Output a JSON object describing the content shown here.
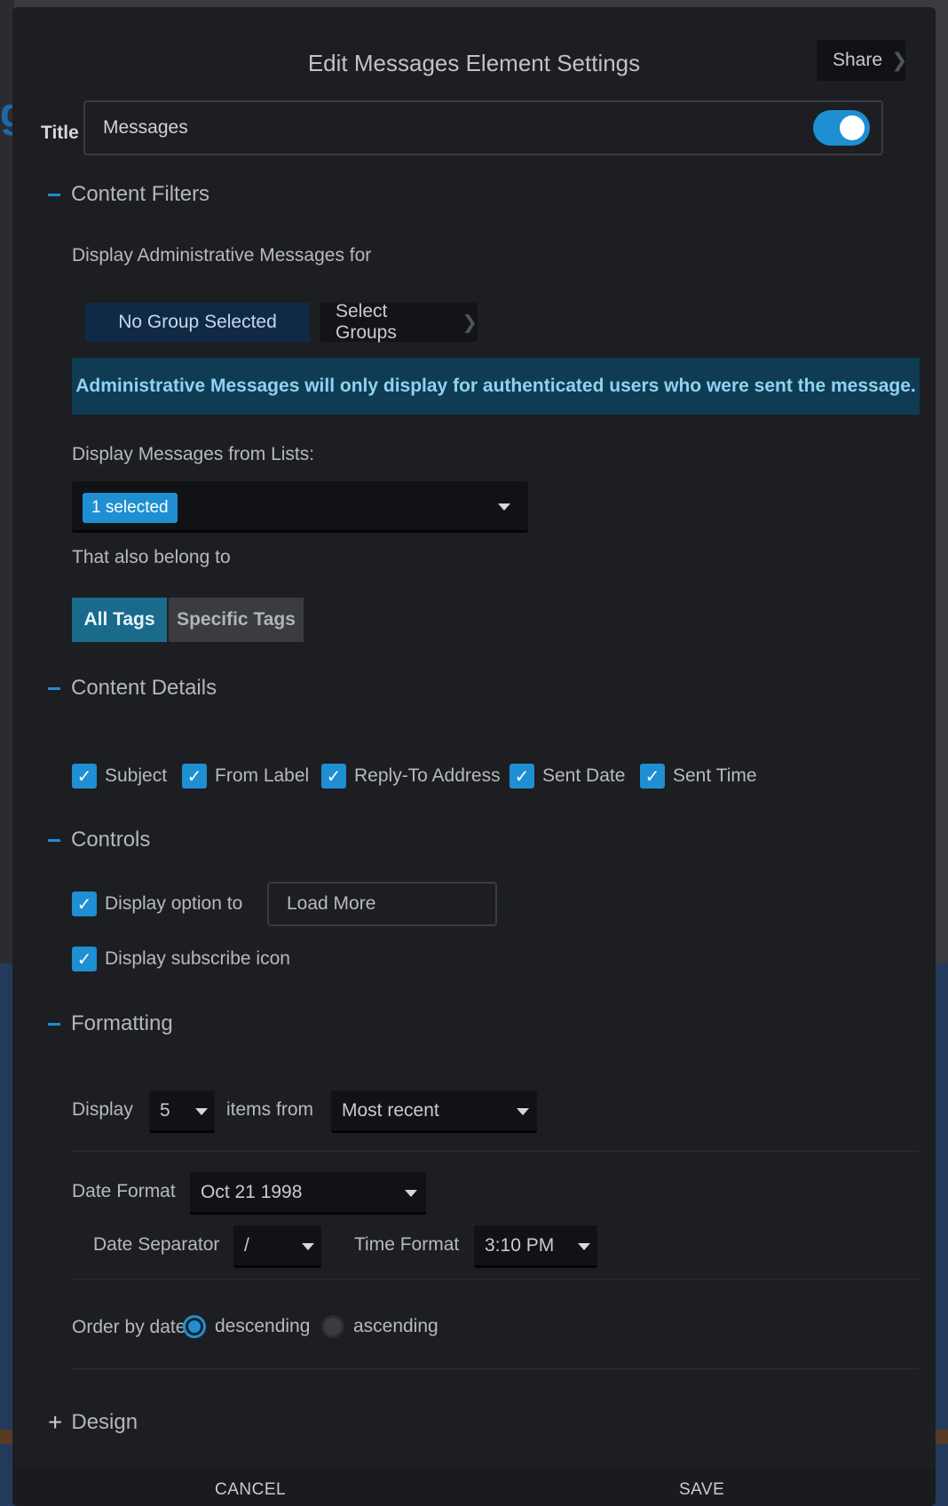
{
  "background": {
    "partial_glyph": "g"
  },
  "modal": {
    "title": "Edit Messages Element Settings",
    "share_label": "Share",
    "title_field": {
      "label": "Title",
      "value": "Messages",
      "toggle_on": true
    }
  },
  "content_filters": {
    "heading": "Content Filters",
    "admin_messages_label": "Display Administrative Messages for",
    "no_group_label": "No Group Selected",
    "select_groups_label": "Select Groups",
    "info_text": "Administrative Messages will only display for authenticated users who were sent the message.",
    "lists_label": "Display Messages from Lists:",
    "lists_selected": "1 selected",
    "belong_label": "That also belong to",
    "tags": {
      "all": "All Tags",
      "specific": "Specific Tags",
      "selected": "All Tags"
    }
  },
  "content_details": {
    "heading": "Content Details",
    "items": [
      {
        "label": "Subject",
        "checked": true
      },
      {
        "label": "From Label",
        "checked": true
      },
      {
        "label": "Reply-To Address",
        "checked": true
      },
      {
        "label": "Sent Date",
        "checked": true
      },
      {
        "label": "Sent Time",
        "checked": true
      }
    ]
  },
  "controls": {
    "heading": "Controls",
    "display_option_label": "Display option to",
    "display_option_value": "Load More",
    "subscribe_label": "Display subscribe icon"
  },
  "formatting": {
    "heading": "Formatting",
    "display_label": "Display",
    "count_value": "5",
    "items_from_label": "items from",
    "items_from_value": "Most recent",
    "date_format_label": "Date Format",
    "date_format_value": "Oct 21 1998",
    "date_separator_label": "Date Separator",
    "date_separator_value": "/",
    "time_format_label": "Time Format",
    "time_format_value": "3:10 PM",
    "order_label": "Order by date",
    "order_descending": "descending",
    "order_ascending": "ascending",
    "order_selected": "descending"
  },
  "design": {
    "heading": "Design"
  },
  "footer": {
    "cancel": "CANCEL",
    "save": "SAVE"
  },
  "colors": {
    "accent": "#1d8fd2",
    "modal_bg": "#1d1e22",
    "info_bg": "#0f3c54",
    "info_text": "#8fd3f2"
  }
}
